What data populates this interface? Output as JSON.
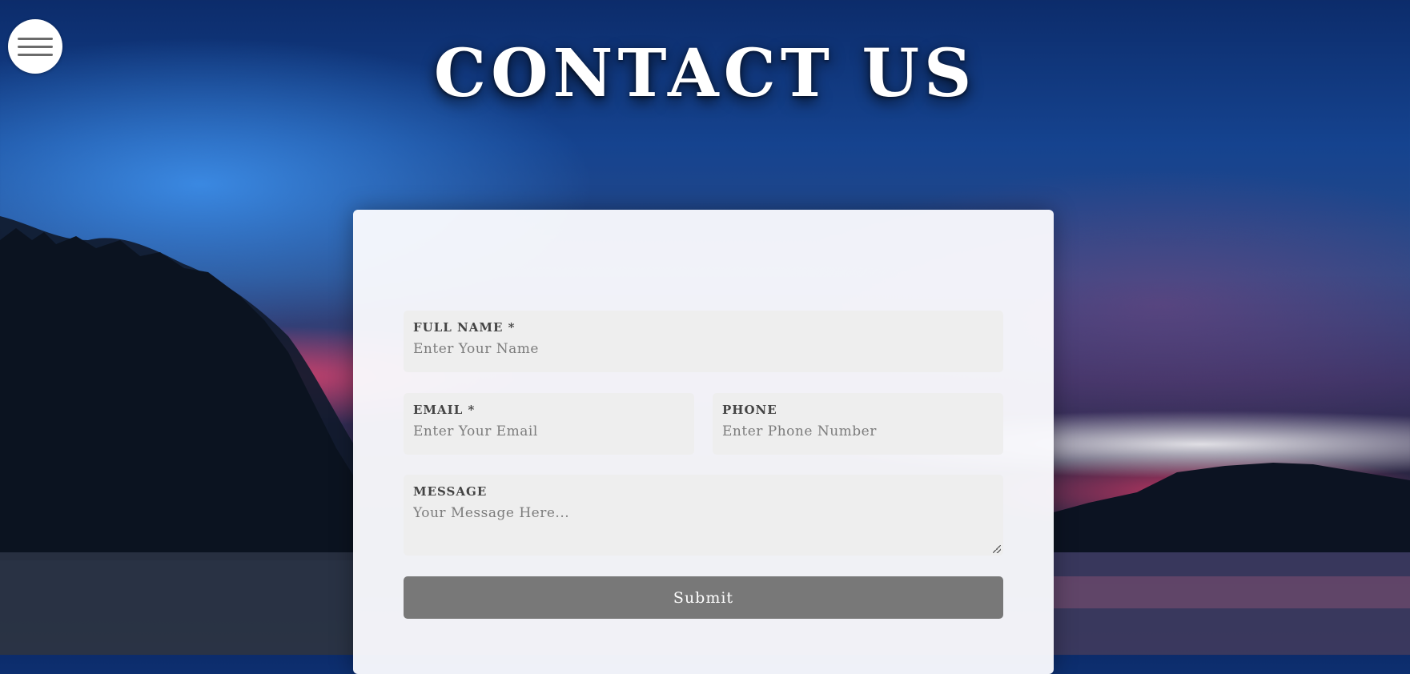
{
  "header": {
    "title": "CONTACT US"
  },
  "menu": {
    "icon": "hamburger-icon"
  },
  "form": {
    "full_name": {
      "label": "FULL NAME *",
      "placeholder": "Enter Your Name",
      "value": ""
    },
    "email": {
      "label": "EMAIL *",
      "placeholder": "Enter Your Email",
      "value": ""
    },
    "phone": {
      "label": "PHONE",
      "placeholder": "Enter Phone Number",
      "value": ""
    },
    "message": {
      "label": "MESSAGE",
      "placeholder": "Your Message Here...",
      "value": ""
    },
    "submit_label": "Submit"
  },
  "colors": {
    "card_background": "#fcfcff",
    "field_background": "#eeeeee",
    "submit_background": "#787878",
    "title_color": "#ffffff"
  }
}
